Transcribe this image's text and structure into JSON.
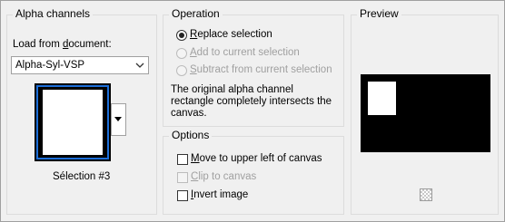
{
  "alpha_channels": {
    "title": "Alpha channels",
    "load_from_label": "Load from ",
    "load_from_label_u": "d",
    "load_from_label_rest": "ocument:",
    "document_value": "Alpha-Syl-VSP",
    "selection_name": "Sélection #3"
  },
  "operation": {
    "title": "Operation",
    "options": [
      {
        "u": "R",
        "rest": "eplace selection",
        "selected": true,
        "enabled": true
      },
      {
        "u": "A",
        "rest": "dd to current selection",
        "selected": false,
        "enabled": false
      },
      {
        "u": "S",
        "rest": "ubtract from current selection",
        "selected": false,
        "enabled": false
      }
    ],
    "message": "The original alpha channel rectangle completely intersects the canvas."
  },
  "options": {
    "title": "Options",
    "items": [
      {
        "u": "M",
        "rest": "ove to upper left of canvas",
        "checked": false,
        "enabled": true
      },
      {
        "u": "C",
        "rest": "lip to canvas",
        "checked": false,
        "enabled": false
      },
      {
        "u": "I",
        "rest": "nvert image",
        "checked": false,
        "enabled": true
      }
    ]
  },
  "preview": {
    "title": "Preview",
    "icon": "checkerboard-icon"
  }
}
